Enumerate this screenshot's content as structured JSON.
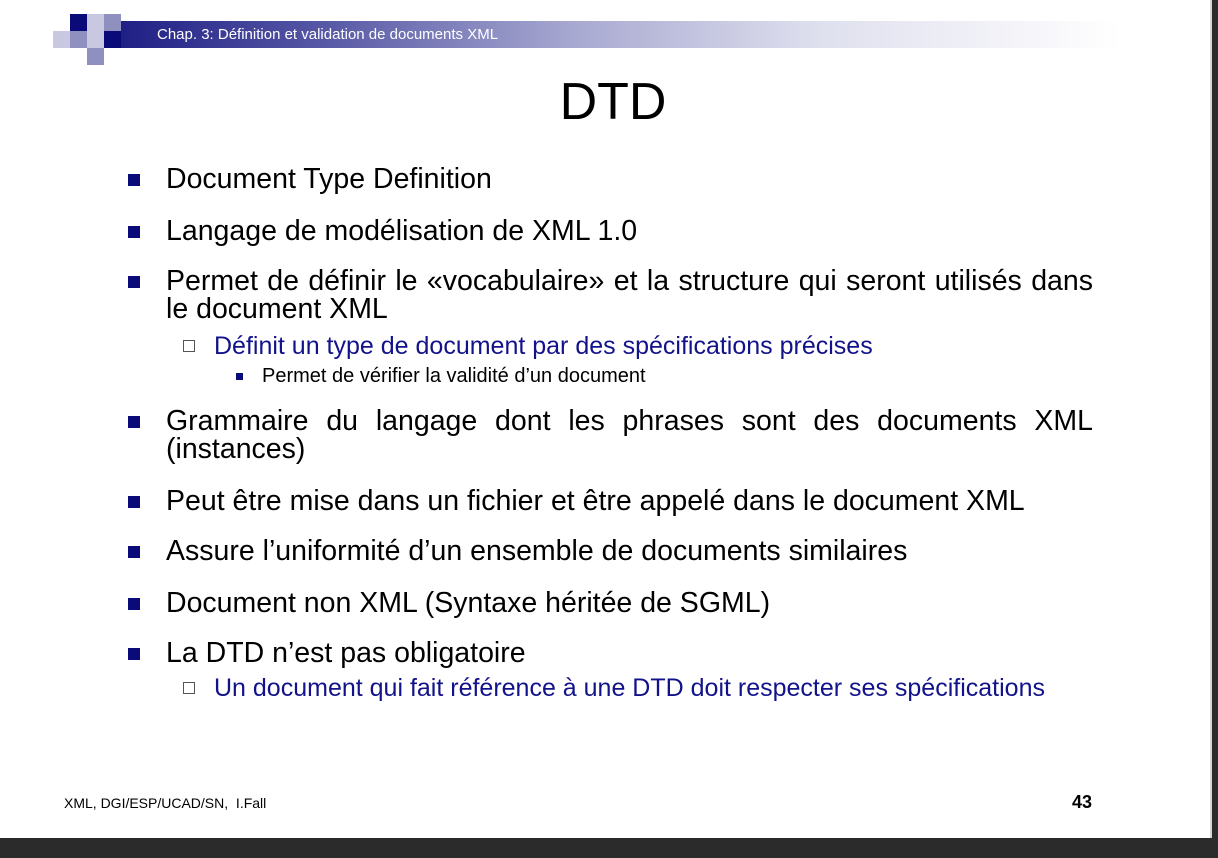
{
  "header": {
    "chapter": "Chap. 3: Définition et validation de documents XML"
  },
  "slide": {
    "title": "DTD"
  },
  "bullets": [
    {
      "text": "Document Type Definition"
    },
    {
      "text": "Langage de modélisation de XML 1.0"
    },
    {
      "text": "Permet de définir le «vocabulaire» et la structure qui seront utilisés dans le document XML"
    },
    {
      "text": "Définit un type de document par des spécifications précises"
    },
    {
      "text": "Permet de vérifier la validité d’un document"
    },
    {
      "text": "Grammaire du langage dont les phrases sont des documents XML (instances)"
    },
    {
      "text": "Peut être mise dans un fichier et être appelé dans le document XML"
    },
    {
      "text": "Assure l’uniformité d’un ensemble de documents similaires"
    },
    {
      "text": "Document non XML (Syntaxe héritée de SGML)"
    },
    {
      "text": "La DTD n’est pas obligatoire"
    },
    {
      "text": "Un document qui fait référence à une DTD doit respecter ses spécifications"
    }
  ],
  "footer": {
    "author": "XML, DGI/ESP/UCAD/SN,  I.Fall",
    "page_number": "43"
  },
  "colors": {
    "accent": "#0a0a78",
    "sub_text": "#12128a"
  },
  "icons": {
    "level1_bullet": "filled-square",
    "level2_bullet": "hollow-square",
    "level3_bullet": "small-filled-square"
  }
}
